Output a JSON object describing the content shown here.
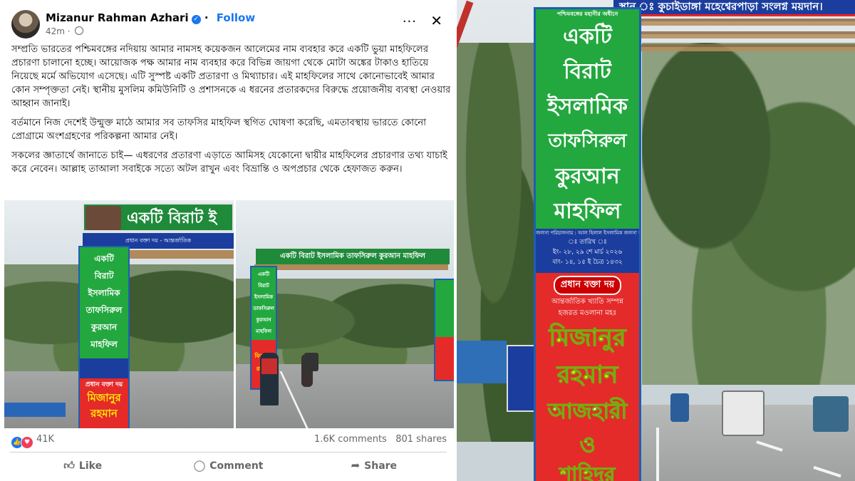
{
  "post": {
    "author": "Mizanur Rahman Azhari",
    "follow_label": "Follow",
    "time": "42m",
    "paragraphs": [
      "সম্প্রতি ভারতের পশ্চিমবঙ্গের নদিয়ায় আমার নামসহ কয়েকজন আলেমের নাম ব্যবহার করে একটি ভুয়া মাহফিলের প্রচারণা চালানো হচ্ছে। আয়োজক পক্ষ আমার নাম ব্যবহার করে বিভিন্ন জায়গা থেকে মোটা অঙ্কের টাকাও হাতিয়ে নিয়েছে মর্মে অভিযোগ এসেছে। এটি সুস্পষ্ট একটি প্রতারণা ও মিথ্যাচার। এই মাহফিলের সাথে কোনোভাবেই আমার কোন সম্পৃক্ততা নেই। স্থানীয় মুসলিম কমিউনিটি ও প্রশাসনকে এ ধরনের প্রতারকদের বিরুদ্ধে প্রয়োজনীয় ব্যবস্থা নেওয়ার আহ্বান জানাই।",
      "বর্তমানে নিজ দেশেই উন্মুক্ত মাঠে আমার সব তাফসির মাহফিল স্থগিত ঘোষণা করেছি, এমতাবস্থায় ভারতে কোনো প্রোগ্রামে অংশগ্রহণের পরিকল্পনা আমার নেই।",
      "সকলের জ্ঞাতার্থে জানাতে চাই— এধরণের প্রতারণা এড়াতে আমিসহ যেকোনো দ্বায়ীর মাহফিলের প্রচারণার তথ্য যাচাই করে নেবেন। আল্লাহ তাআলা সবাইকে সত্যে অটল রাখুন এবং বিভ্রান্তি ও অপপ্রচার থেকে হেফাজত করুন।"
    ],
    "reaction_count": "41K",
    "comments": "1.6K comments",
    "shares": "801 shares",
    "actions": {
      "like": "Like",
      "comment": "Comment",
      "share": "Share"
    },
    "photo1": {
      "top_banner": "একটি বিরাট ই",
      "sub_banner": "প্রধান বক্তা দয় - আন্তর্জাতিক",
      "vertical": [
        "একটি",
        "বিরাট",
        "ইসলামিক",
        "তাফসিরুল",
        "কুরআন",
        "মাহফিল"
      ],
      "red": [
        "প্রধান বক্তা দয়",
        "মিজানুর",
        "রহমান"
      ]
    },
    "photo2": {
      "top_banner": "একটি বিরাট ইসলামিক তাফসিরুল কুরআন মাহফিল",
      "vertical": [
        "একটি",
        "বিরাট",
        "ইসলামিক",
        "তাফসিরুল",
        "কুরআন",
        "মাহফিল"
      ],
      "red": [
        "মিজানুর",
        "রহমান"
      ]
    }
  },
  "photo3": {
    "top_banner": "স্থান ঃ কুচাইডাঙ্গা মহেশ্বেরপাড়া সংলগ্ন ময়দান।",
    "small_top": "পশ্চিমবঙ্গের মহানীর অধীনে",
    "words": [
      "একটি",
      "বিরাট",
      "ইসলামিক",
      "তাফসিরুল",
      "কুরআন",
      "মাহফিল"
    ],
    "committee": "জলসা পরিচালনায় : আল হিলাল ইসলামিক জলসা কমিটি",
    "date_label": "ঃ তারিখ ঃ",
    "date_en": "ইং- ২৮, ২৯ শে মার্চ ২০২৬",
    "date_bn": "বাং- ১৪, ১৫ ই চৈত্র ১৪৩২",
    "speakers_pill": "প্রধান বক্তা দয়",
    "fame": "আন্তর্জাতিক খ্যাতি সম্পন্ন",
    "title": "হজরত মওলানা মহঃ",
    "names": [
      "মিজানুর",
      "রহমান",
      "আজহারী",
      "ও",
      "শাহিদুর"
    ]
  },
  "colors": {
    "fb_blue": "#1877f2",
    "banner_green": "#22a83f",
    "banner_red": "#e52a2a",
    "banner_blue": "#1b3d9e"
  }
}
